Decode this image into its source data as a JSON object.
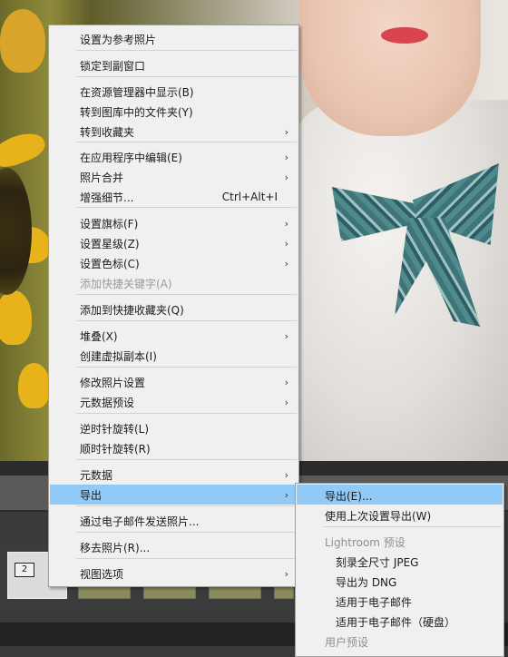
{
  "main_menu": {
    "items": [
      {
        "label": "设置为参考照片"
      },
      {
        "label": "锁定到副窗口"
      },
      {
        "label": "在资源管理器中显示(B)"
      },
      {
        "label": "转到图库中的文件夹(Y)"
      },
      {
        "label": "转到收藏夹",
        "submenu": true
      },
      {
        "label": "在应用程序中编辑(E)",
        "submenu": true
      },
      {
        "label": "照片合并",
        "submenu": true
      },
      {
        "label": "增强细节...",
        "shortcut": "Ctrl+Alt+I"
      },
      {
        "label": "设置旗标(F)",
        "submenu": true
      },
      {
        "label": "设置星级(Z)",
        "submenu": true
      },
      {
        "label": "设置色标(C)",
        "submenu": true
      },
      {
        "label": "添加快捷关键字(A)",
        "disabled": true
      },
      {
        "label": "添加到快捷收藏夹(Q)"
      },
      {
        "label": "堆叠(X)",
        "submenu": true
      },
      {
        "label": "创建虚拟副本(I)"
      },
      {
        "label": "修改照片设置",
        "submenu": true
      },
      {
        "label": "元数据预设",
        "submenu": true
      },
      {
        "label": "逆时针旋转(L)"
      },
      {
        "label": "顺时针旋转(R)"
      },
      {
        "label": "元数据",
        "submenu": true
      },
      {
        "label": "导出",
        "submenu": true,
        "highlighted": true
      },
      {
        "label": "通过电子邮件发送照片..."
      },
      {
        "label": "移去照片(R)..."
      },
      {
        "label": "视图选项",
        "submenu": true
      }
    ],
    "arrow_glyph": "›"
  },
  "export_submenu": {
    "items": [
      {
        "label": "导出(E)...",
        "highlighted": true
      },
      {
        "label": "使用上次设置导出(W)"
      },
      {
        "label": "Lightroom 预设",
        "header": true
      },
      {
        "label": "刻录全尺寸 JPEG",
        "indent": true
      },
      {
        "label": "导出为 DNG",
        "indent": true
      },
      {
        "label": "适用于电子邮件",
        "indent": true
      },
      {
        "label": "适用于电子邮件（硬盘）",
        "indent": true
      },
      {
        "label": "用户预设",
        "header": true
      }
    ]
  },
  "filmstrip": {
    "selected_badge": "2"
  },
  "colors": {
    "menu_bg": "#f0f0f0",
    "highlight": "#91c9f7",
    "disabled_text": "#9a9a9a"
  }
}
